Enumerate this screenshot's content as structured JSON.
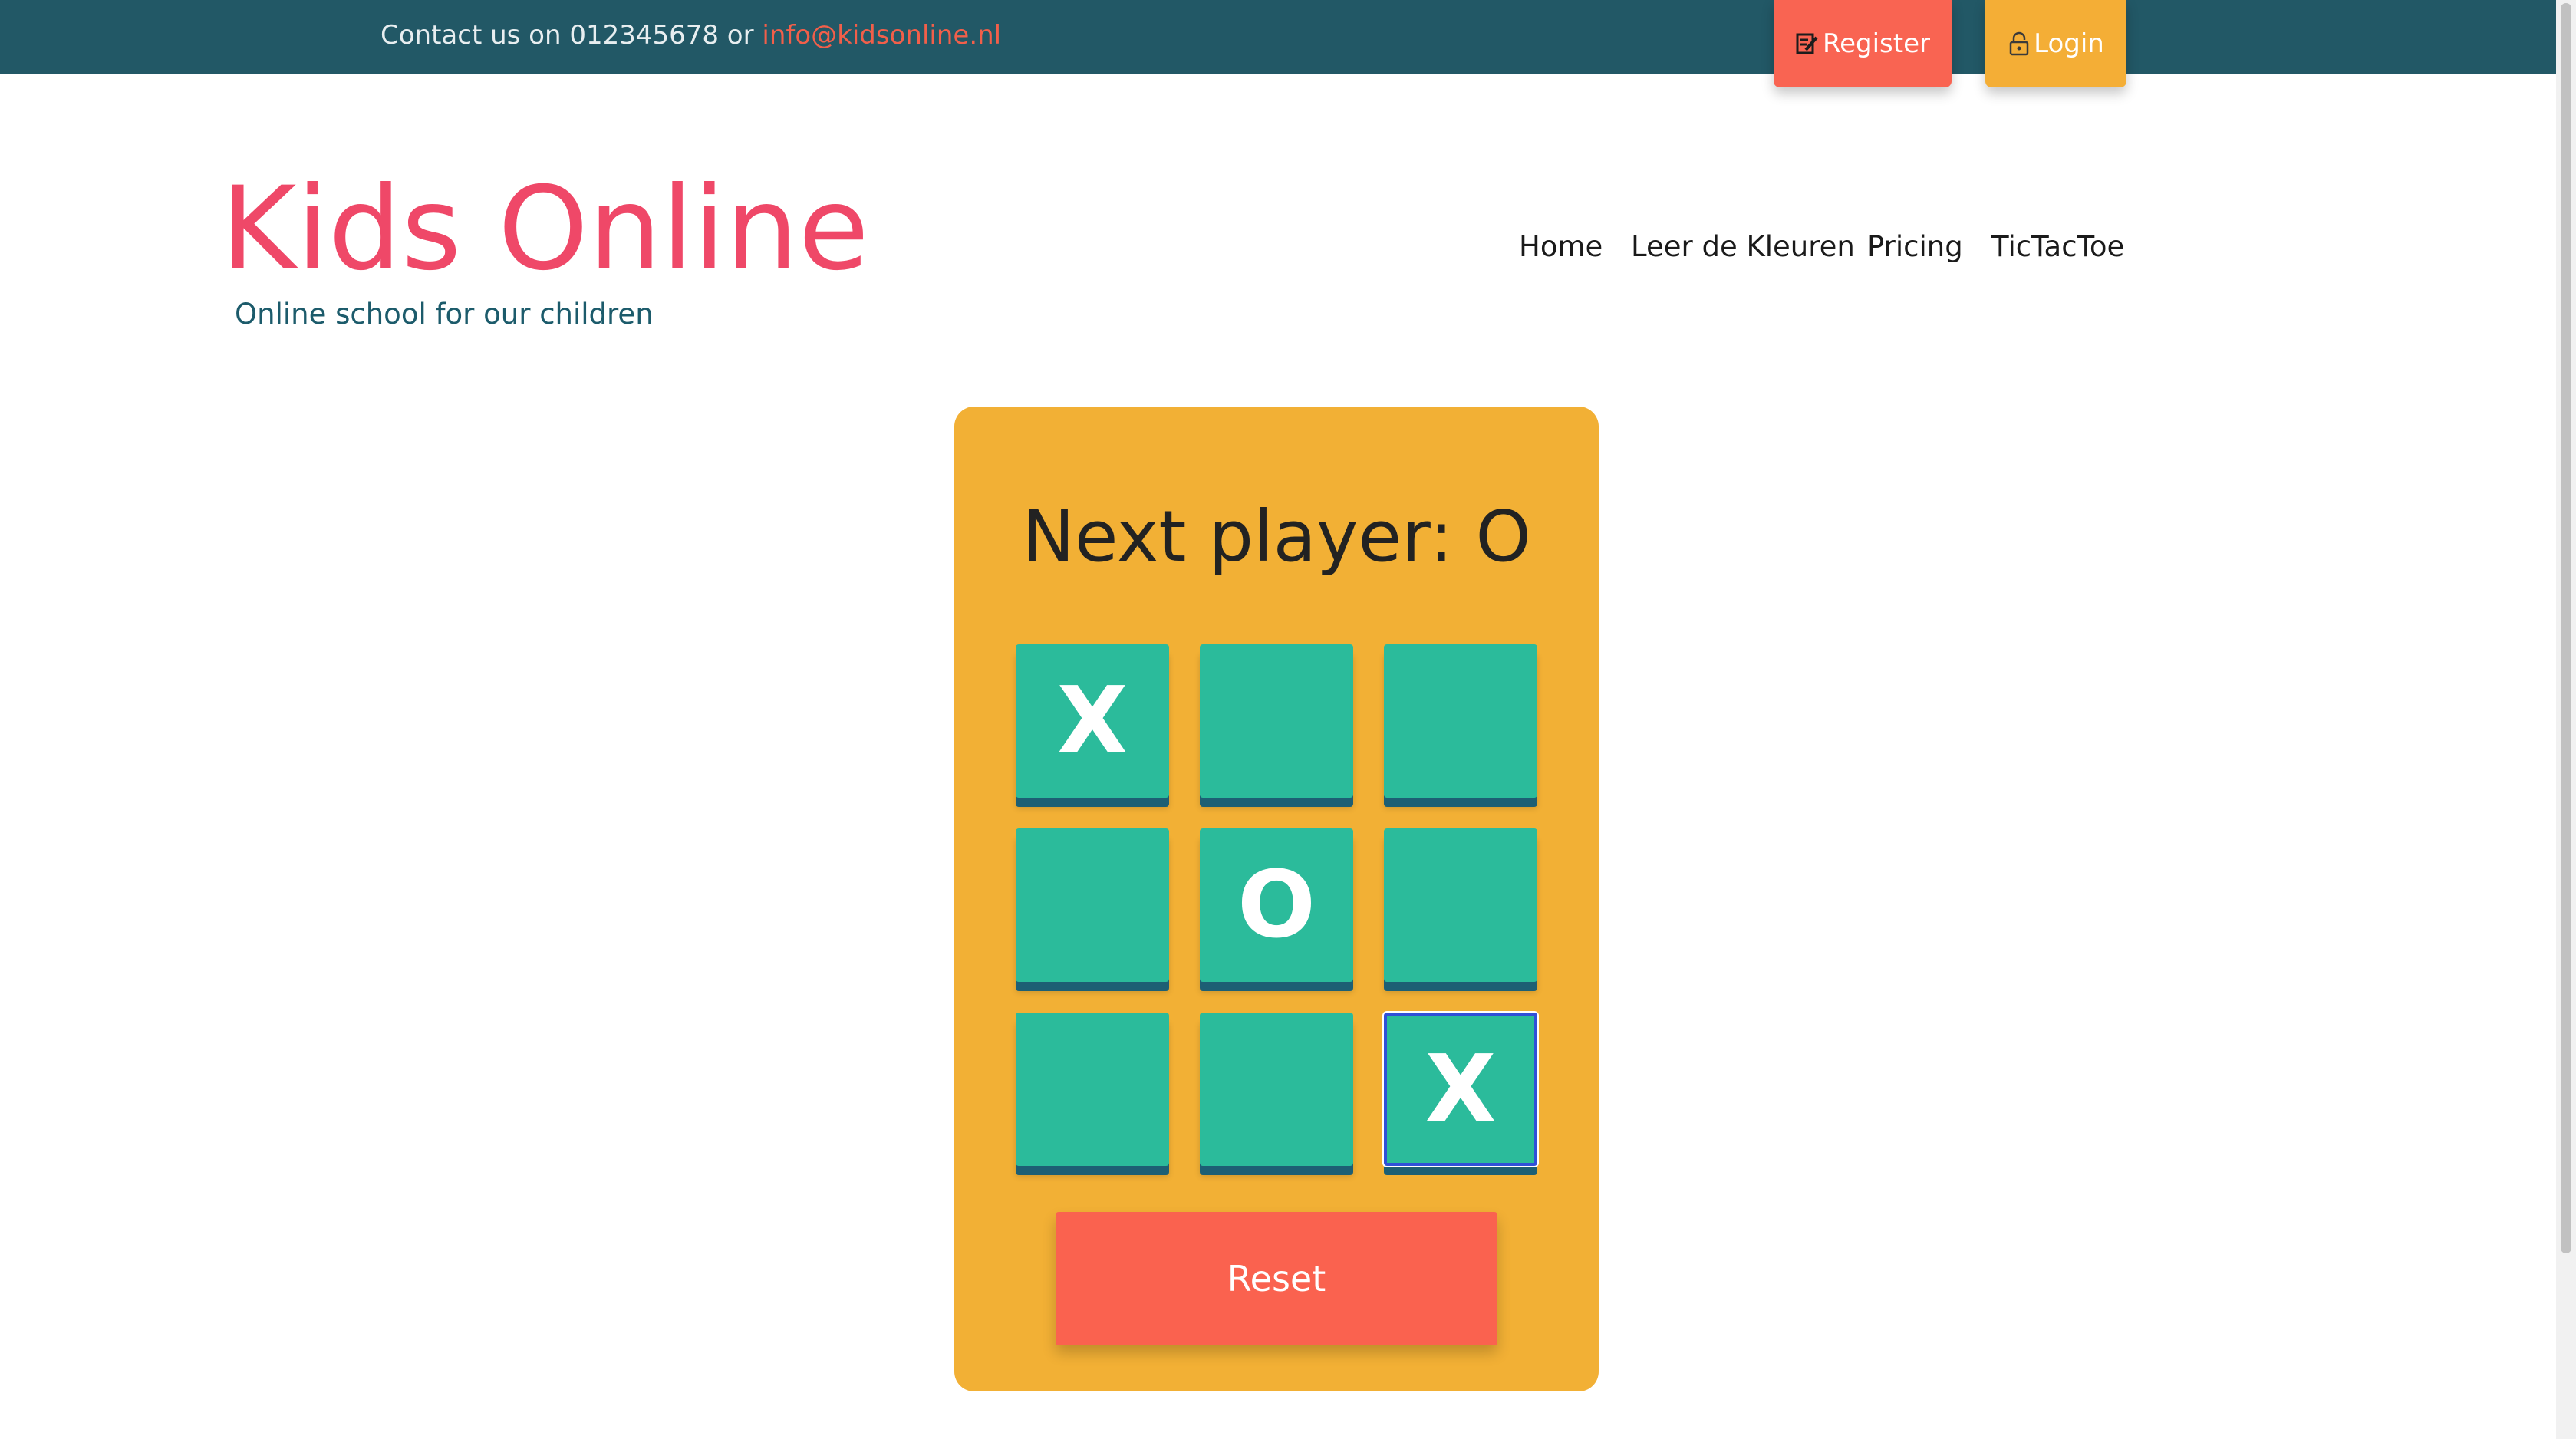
{
  "topbar": {
    "contact_prefix": "Contact us on 012345678 or ",
    "email": "info@kidsonline.nl",
    "register_label": "Register",
    "login_label": "Login",
    "register_icon": "edit-icon",
    "login_icon": "lock-icon",
    "background_color": "#225866"
  },
  "header": {
    "brand": "Kids Online",
    "tagline": "Online school for our children",
    "brand_color": "#ef4868"
  },
  "nav": {
    "items": [
      {
        "label": "Home"
      },
      {
        "label": "Leer de Kleuren"
      },
      {
        "label": "Pricing"
      },
      {
        "label": "TicTacToe"
      }
    ]
  },
  "game": {
    "status": "Next player: O",
    "board": [
      "X",
      "",
      "",
      "",
      "O",
      "",
      "",
      "",
      "X"
    ],
    "reset_label": "Reset",
    "card_color": "#f2b035",
    "square_color": "#2bbb9b",
    "reset_color": "#fa624f"
  }
}
